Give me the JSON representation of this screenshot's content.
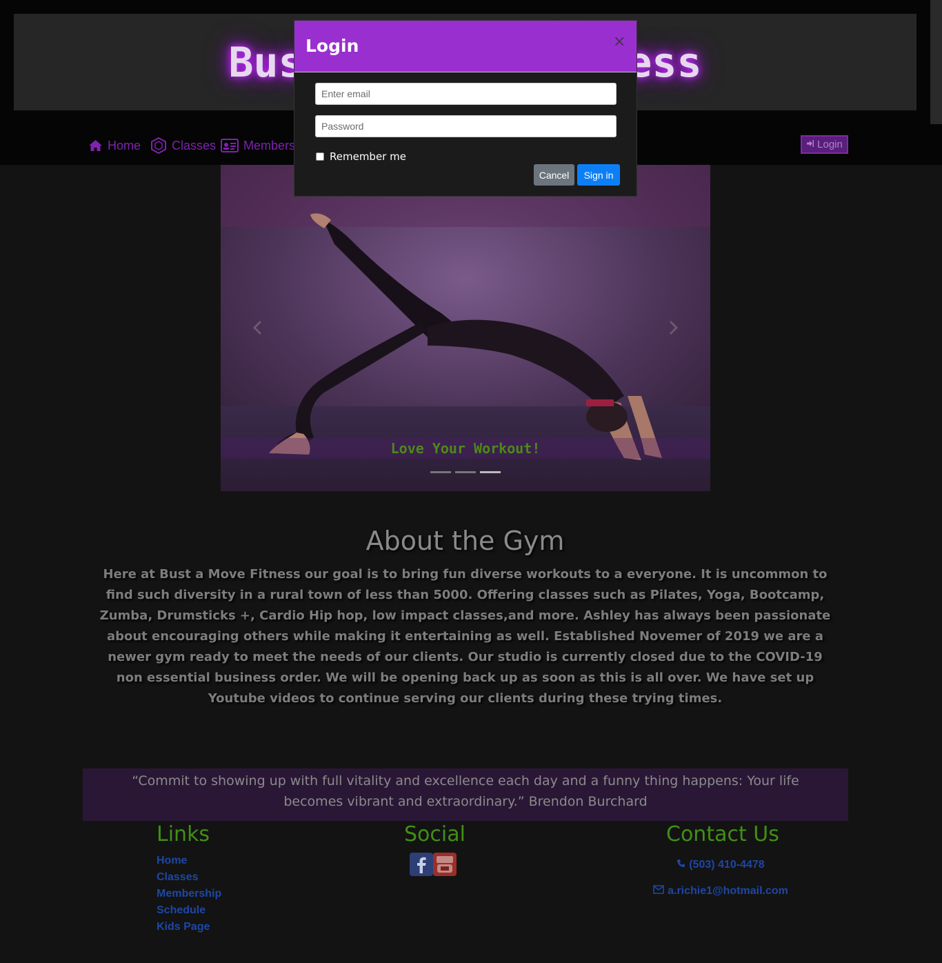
{
  "brand": {
    "title": "Bust a Move Fitness"
  },
  "nav": {
    "items": [
      {
        "label": "Home",
        "icon": "home-icon"
      },
      {
        "label": "Classes",
        "icon": "hexagon-icon"
      },
      {
        "label": "Members",
        "icon": "id-card-icon"
      }
    ],
    "login_label": "Login"
  },
  "carousel": {
    "caption": "Love Your Workout!",
    "slide_count": 3,
    "active_slide": 3
  },
  "about": {
    "title": "About the Gym",
    "text": "Here at Bust a Move Fitness our goal is to bring fun diverse workouts to a everyone. It is uncommon to find such diversity in a rural town of less than 5000. Offering classes such as Pilates, Yoga, Bootcamp, Zumba, Drumsticks +, Cardio Hip hop, low impact classes,and more. Ashley has always been passionate about encouraging others while making it entertaining as well. Established Novemer of 2019 we are a newer gym ready to meet the needs of our clients. Our studio is currently closed due to the COVID-19 non essential business order. We will be opening back up as soon as this is all over. We have set up Youtube videos to continue serving our clients during these trying times."
  },
  "quote": {
    "text": "“Commit to showing up with full vitality and excellence each day and a funny thing happens: Your life becomes vibrant and extraordinary.” Brendon Burchard"
  },
  "footer": {
    "links_title": "Links",
    "links": [
      "Home",
      "Classes",
      "Membership",
      "Schedule",
      "Kids Page"
    ],
    "social_title": "Social",
    "social": [
      "facebook-icon",
      "youtube-icon"
    ],
    "contact_title": "Contact Us",
    "phone": "(503) 410-4478",
    "email": "a.richie1@hotmail.com"
  },
  "modal": {
    "title": "Login",
    "close": "×",
    "email_placeholder": "Enter email",
    "password_placeholder": "Password",
    "remember_label": "Remember me",
    "cancel_label": "Cancel",
    "signin_label": "Sign in"
  },
  "colors": {
    "accent": "#9a2fd0",
    "nav_text": "#7f22b0",
    "footer_heading": "#418f14",
    "link": "#1d47a6",
    "signin": "#0d7ff6"
  }
}
